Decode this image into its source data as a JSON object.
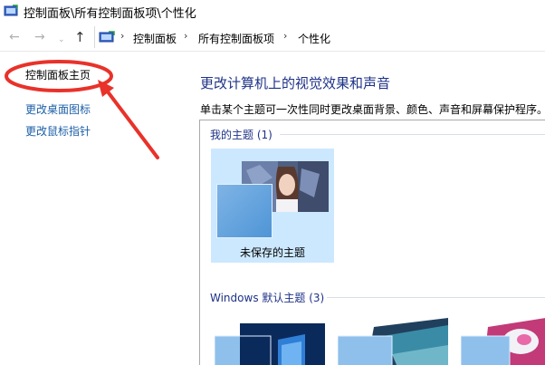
{
  "window": {
    "title": "控制面板\\所有控制面板项\\个性化"
  },
  "nav": {
    "back": "←",
    "forward": "→",
    "recent": "⌄",
    "up": "↑",
    "breadcrumbs": [
      "控制面板",
      "所有控制面板项",
      "个性化"
    ],
    "separator": "›"
  },
  "sidebar": {
    "items": [
      {
        "label": "控制面板主页"
      },
      {
        "label": "更改桌面图标"
      },
      {
        "label": "更改鼠标指针"
      }
    ]
  },
  "main": {
    "heading": "更改计算机上的视觉效果和声音",
    "description": "单击某个主题可一次性同时更改桌面背景、颜色、声音和屏幕保护程序。",
    "my_themes_header": "我的主题 (1)",
    "my_themes": [
      {
        "label": "未保存的主题"
      }
    ],
    "windows_themes_header": "Windows 默认主题 (3)",
    "windows_themes": [
      {
        "name": "windows-10-theme-thumbnail"
      },
      {
        "name": "lines-theme-thumbnail"
      },
      {
        "name": "flowers-theme-thumbnail"
      }
    ]
  },
  "colors": {
    "annotation_red": "#e8322a",
    "heading_blue": "#1e3287",
    "link_blue": "#1c5fa8",
    "selection_blue": "#cce8ff"
  }
}
